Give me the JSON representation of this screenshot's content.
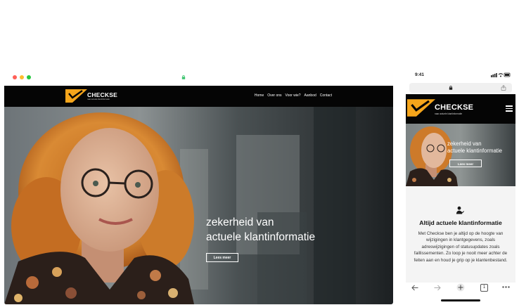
{
  "colors": {
    "accent": "#f5a51b",
    "nav_bg": "#050505",
    "dot_red": "#ff5f57",
    "dot_yellow": "#febc2e",
    "dot_green": "#28c840"
  },
  "brand": {
    "name": "CHECKSE",
    "tagline": "naar actuele klantinformatie"
  },
  "desktop": {
    "nav_links": [
      "Home",
      "Over ons",
      "Voor wie?",
      "Aanbod",
      "Contact"
    ],
    "hero": {
      "title_line1": "zekerheid van",
      "title_line2": "actuele klantinformatie",
      "button": "Lees meer"
    }
  },
  "mobile": {
    "status_time": "9:41",
    "hero": {
      "title_line1": "zekerheid van",
      "title_line2": "actuele klantinformatie",
      "button": "Lees meer"
    },
    "section": {
      "icon": "person-icon",
      "title": "Altijd actuele klantinformatie",
      "body": "Met Checkse ben je altijd op de hoogte van wijzigingen in klantgegevens, zoals adreswijzigingen of statusupdates zoals faillissementen. Zo loop je nooit meer achter de feiten aan en houd je grip op je klantenbestand."
    },
    "toolbar": {
      "back": "back-icon",
      "forward": "forward-icon",
      "add": "plus-icon",
      "tabs": "1",
      "more": "more-icon"
    }
  }
}
